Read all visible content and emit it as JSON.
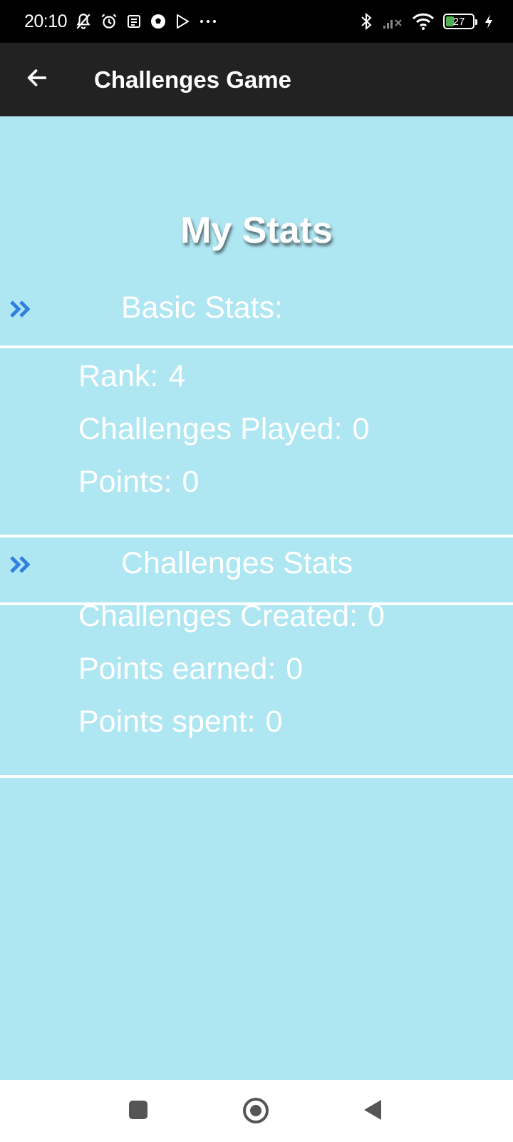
{
  "status_bar": {
    "time": "20:10",
    "battery_level": "27",
    "icons": [
      "muted-bell-icon",
      "alarm-icon",
      "news-icon",
      "soccer-icon",
      "play-store-icon",
      "more-dots-icon",
      "bluetooth-icon",
      "signal-icon",
      "wifi-icon",
      "battery-icon",
      "charging-icon"
    ]
  },
  "app_bar": {
    "title": "Challenges Game",
    "back_icon": "arrow-left-icon"
  },
  "page": {
    "title": "My Stats"
  },
  "sections": [
    {
      "title": "Basic Stats:",
      "stats": [
        {
          "label": "Rank:",
          "value": "4"
        },
        {
          "label": "Challenges Played:",
          "value": "0"
        },
        {
          "label": "Points:",
          "value": "0"
        }
      ]
    },
    {
      "title": "Challenges Stats",
      "stats": [
        {
          "label": "Challenges Created:",
          "value": "0"
        },
        {
          "label": "Points earned:",
          "value": "0"
        },
        {
          "label": "Points spent:",
          "value": "0"
        }
      ]
    }
  ],
  "nav_bar": {
    "icons": [
      "recents-square-icon",
      "home-circle-icon",
      "back-triangle-icon"
    ]
  },
  "colors": {
    "background": "#aee6f2",
    "app_bar": "#222222",
    "chevron": "#2f80e0",
    "text": "#ffffff"
  }
}
